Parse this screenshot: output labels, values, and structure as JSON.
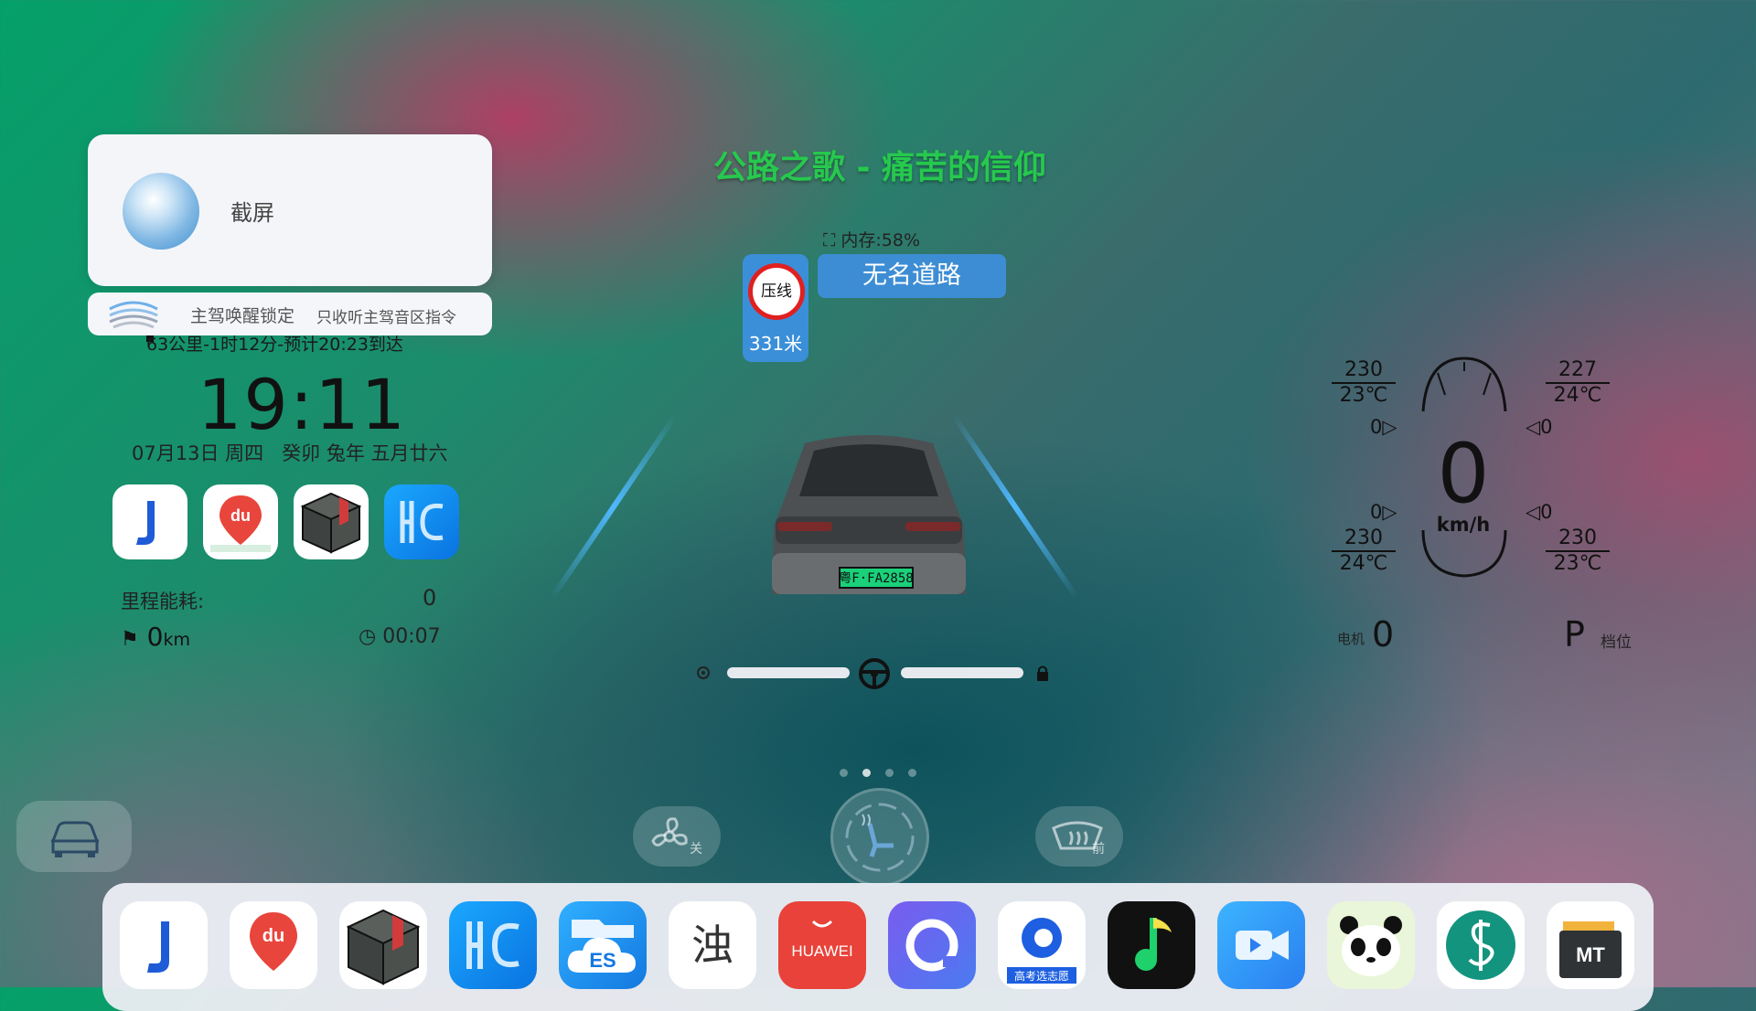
{
  "toast": {
    "label": "截屏"
  },
  "voice": {
    "title": "主驾唤醒锁定",
    "subtitle": "只收听主驾音区指令"
  },
  "nav": {
    "route_info": "63公里-1时12分-预计20:23到达",
    "song": "公路之歌 - 痛苦的信仰",
    "memory": "内存:58%",
    "sign_text": "压线",
    "sign_distance": "331米",
    "road_name": "无名道路"
  },
  "clock": {
    "time": "19:11",
    "date": "07月13日 周四",
    "lunar": "癸卯 兔年 五月廿六"
  },
  "stats": {
    "label": "里程能耗:",
    "value": "0",
    "odometer": "0",
    "odometer_unit": "km",
    "duration": "00:07"
  },
  "car": {
    "plate": "粤F·FA2858"
  },
  "tires": {
    "fl": {
      "pressure": "230",
      "temp": "23℃"
    },
    "fr": {
      "pressure": "227",
      "temp": "24℃"
    },
    "rl": {
      "pressure": "230",
      "temp": "24℃"
    },
    "rr": {
      "pressure": "230",
      "temp": "23℃"
    }
  },
  "indicators": {
    "fl": "0",
    "fr": "0",
    "rl": "0",
    "rr": "0"
  },
  "speed": {
    "value": "0",
    "unit": "km/h"
  },
  "motor": {
    "label": "电机",
    "value": "0"
  },
  "gear": {
    "value": "P",
    "label": "档位"
  },
  "controls": {
    "fan_state": "关",
    "defrost_label": "前"
  },
  "page_dots": {
    "count": 4,
    "active": 1
  },
  "widget_apps": [
    "jianying-app",
    "baidu-map-app",
    "box-app",
    "hc-app"
  ],
  "dock_apps": [
    {
      "name": "jianying-app"
    },
    {
      "name": "baidu-map-app"
    },
    {
      "name": "box-app"
    },
    {
      "name": "hc-app"
    },
    {
      "name": "es-file-app"
    },
    {
      "name": "zhuo-app"
    },
    {
      "name": "huawei-app",
      "label": "HUAWEI"
    },
    {
      "name": "browser-app"
    },
    {
      "name": "gaokao-app",
      "label": "高考选志愿"
    },
    {
      "name": "music-app"
    },
    {
      "name": "video-app"
    },
    {
      "name": "panda-app"
    },
    {
      "name": "s-app"
    },
    {
      "name": "mt-app",
      "label": "MT"
    }
  ],
  "colors": {
    "song": "#26c94d",
    "road_badge": "#3d8dd4",
    "sign_ring": "#e02020",
    "lane": "#4fb8ff"
  }
}
